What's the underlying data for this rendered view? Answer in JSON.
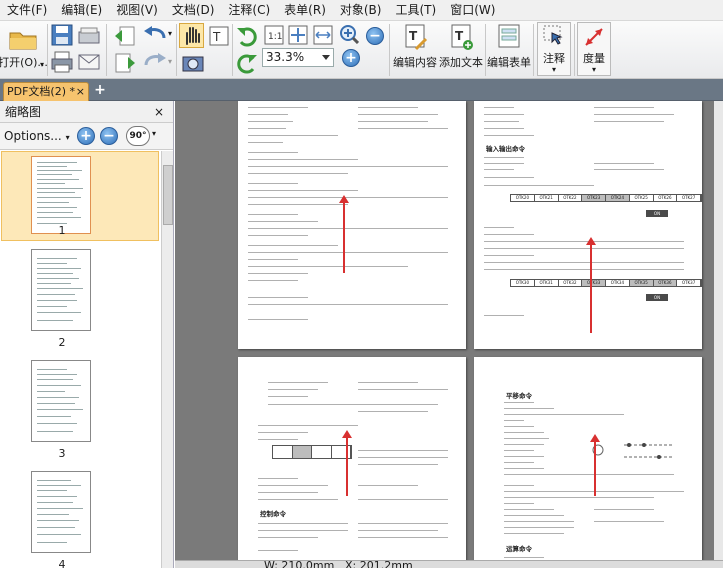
{
  "menubar": {
    "items": [
      "文件(F)",
      "编辑(E)",
      "视图(V)",
      "文档(D)",
      "注释(C)",
      "表单(R)",
      "对象(B)",
      "工具(T)",
      "窗口(W)"
    ]
  },
  "toolbar": {
    "open_label": "打开(O)...",
    "zoom_value": "33.3%",
    "edit_content_label": "编辑内容",
    "add_text_label": "添加文本",
    "edit_form_label": "编辑表单",
    "annotation_label": "注释",
    "measure_label": "度量"
  },
  "tab": {
    "label": "PDF文档(2) *",
    "close": "×",
    "add": "+"
  },
  "sidebar": {
    "title": "缩略图",
    "close": "×",
    "options_label": "Options...",
    "zoom_in": "+",
    "zoom_out": "−",
    "rotate_label": "90°",
    "thumbnails": [
      {
        "label": "1",
        "selected": true
      },
      {
        "label": "2",
        "selected": false
      },
      {
        "label": "3",
        "selected": false
      },
      {
        "label": "4",
        "selected": false
      }
    ]
  },
  "pages": {
    "top_left_heading": "",
    "top_right_heading": "输入输出命令",
    "bottom_left_heading": "控制命令",
    "bottom_right_heading": "平移命令",
    "bottom_right_heading2": "运算命令",
    "table_tr1": [
      "OTK20",
      "OTK21",
      "OTK22",
      "OTK23",
      "OTK24",
      "OTK25",
      "OTK26",
      "OTK27"
    ],
    "table_tr2": [
      "OTK30",
      "OTK31",
      "OTK32",
      "OTK33",
      "OTK34",
      "OTK35",
      "OTK36",
      "OTK37"
    ],
    "on_label": "ON"
  },
  "statusbar": {
    "width_text": "W: 210.0mm",
    "x_text": "X: 201.2mm"
  },
  "colors": {
    "tabbar": "#6a7785",
    "tab_active": "#f6c36e",
    "thumb_selected": "#fde8b8",
    "arrow": "#d83030"
  }
}
